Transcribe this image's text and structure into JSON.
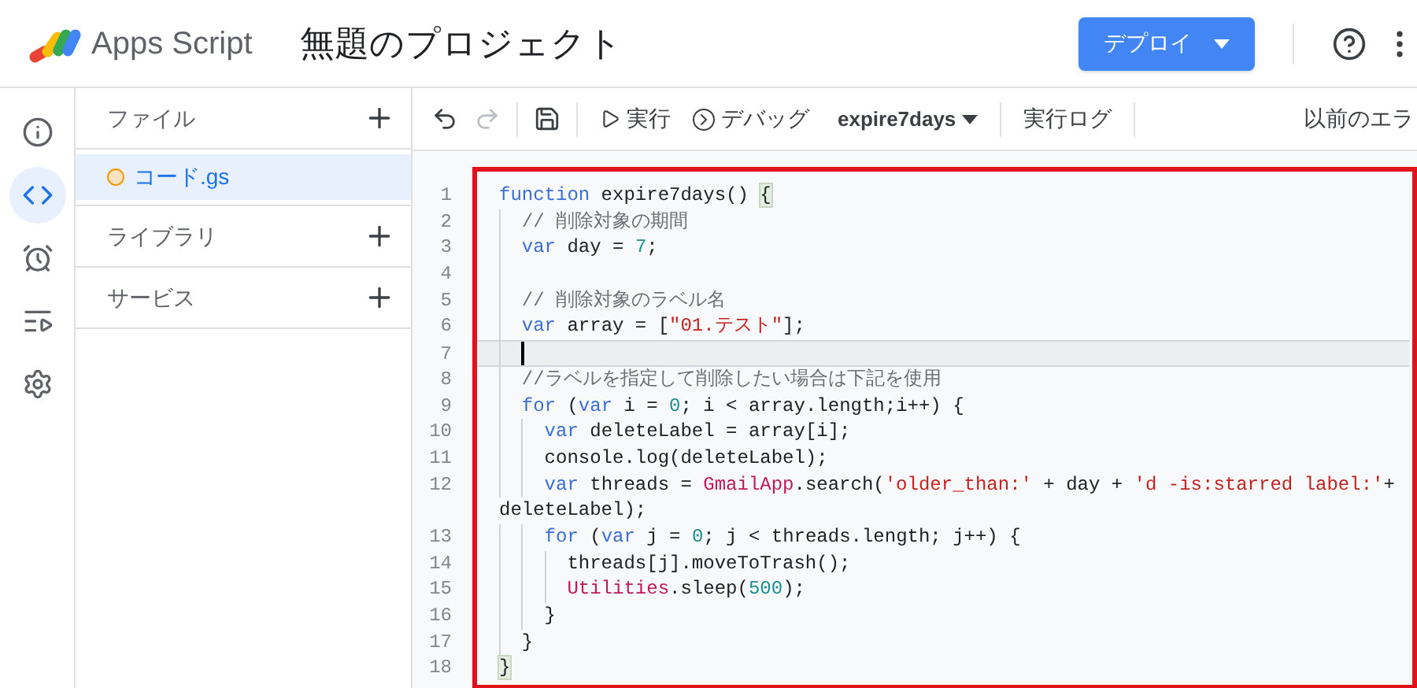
{
  "header": {
    "product": "Apps Script",
    "project_title": "無題のプロジェクト",
    "deploy_button": "デプロイ"
  },
  "rail": [
    {
      "kind": "info",
      "selected": false
    },
    {
      "kind": "editor",
      "selected": true
    },
    {
      "kind": "triggers",
      "selected": false
    },
    {
      "kind": "executions",
      "selected": false
    },
    {
      "kind": "settings",
      "selected": false
    }
  ],
  "files_panel": [
    {
      "title": "ファイル",
      "files": [
        {
          "name": "コード.gs",
          "selected": true
        }
      ]
    },
    {
      "title": "ライブラリ"
    },
    {
      "title": "サービス"
    }
  ],
  "toolbar": {
    "run": "実行",
    "debug": "デバッグ",
    "function_select": "expire7days",
    "log": "実行ログ",
    "previous": "以前のエラ"
  },
  "editor": {
    "lines": [
      {
        "number": "1",
        "current": false,
        "tokens": [
          {
            "kind": "kw",
            "text": "function"
          },
          {
            "kind": "plain",
            "text": " expire7days() "
          },
          {
            "kind": "bracket",
            "text": "{"
          }
        ]
      },
      {
        "number": "2",
        "current": false,
        "tokens": [
          {
            "kind": "comment",
            "text": "  // 削除対象の期間"
          }
        ]
      },
      {
        "number": "3",
        "current": false,
        "tokens": [
          {
            "kind": "kw",
            "text": "  var"
          },
          {
            "kind": "plain",
            "text": " day = "
          },
          {
            "kind": "num",
            "text": "7"
          },
          {
            "kind": "plain",
            "text": ";"
          }
        ]
      },
      {
        "number": "4",
        "current": false
      },
      {
        "number": "5",
        "current": false,
        "tokens": [
          {
            "kind": "comment",
            "text": "  // 削除対象のラベル名"
          }
        ]
      },
      {
        "number": "6",
        "current": false,
        "tokens": [
          {
            "kind": "kw",
            "text": "  var"
          },
          {
            "kind": "plain",
            "text": " array = ["
          },
          {
            "kind": "str",
            "text": "\"01.テスト\""
          },
          {
            "kind": "plain",
            "text": "];"
          }
        ]
      },
      {
        "number": "7",
        "current": true
      },
      {
        "number": "8",
        "current": false,
        "tokens": [
          {
            "kind": "comment",
            "text": "  //ラベルを指定して削除したい場合は下記を使用"
          }
        ]
      },
      {
        "number": "9",
        "current": false,
        "tokens": [
          {
            "kind": "kw",
            "text": "  for"
          },
          {
            "kind": "plain",
            "text": " ("
          },
          {
            "kind": "kw",
            "text": "var"
          },
          {
            "kind": "plain",
            "text": " i = "
          },
          {
            "kind": "num",
            "text": "0"
          },
          {
            "kind": "plain",
            "text": "; i < array.length;i++) {"
          }
        ]
      },
      {
        "number": "10",
        "current": false,
        "tokens": [
          {
            "kind": "kw",
            "text": "    var"
          },
          {
            "kind": "plain",
            "text": " deleteLabel = array[i];"
          }
        ]
      },
      {
        "number": "11",
        "current": false,
        "tokens": [
          {
            "kind": "plain",
            "text": "    console.log(deleteLabel);"
          }
        ]
      },
      {
        "number": "12",
        "current": false,
        "tokens": [
          {
            "kind": "kw",
            "text": "    var"
          },
          {
            "kind": "plain",
            "text": " threads = "
          },
          {
            "kind": "cls",
            "text": "GmailApp"
          },
          {
            "kind": "plain",
            "text": ".search("
          },
          {
            "kind": "str",
            "text": "'older_than:'"
          },
          {
            "kind": "plain",
            "text": " + day + "
          },
          {
            "kind": "str",
            "text": "'d -is:starred label:'"
          },
          {
            "kind": "plain",
            "text": "+"
          }
        ],
        "continuation": "deleteLabel);"
      },
      {
        "number": "13",
        "current": false,
        "tokens": [
          {
            "kind": "kw",
            "text": "    for"
          },
          {
            "kind": "plain",
            "text": " ("
          },
          {
            "kind": "kw",
            "text": "var"
          },
          {
            "kind": "plain",
            "text": " j = "
          },
          {
            "kind": "num",
            "text": "0"
          },
          {
            "kind": "plain",
            "text": "; j < threads.length; j++) {"
          }
        ]
      },
      {
        "number": "14",
        "current": false,
        "tokens": [
          {
            "kind": "plain",
            "text": "      threads[j].moveToTrash();"
          }
        ]
      },
      {
        "number": "15",
        "current": false,
        "tokens": [
          {
            "kind": "cls",
            "text": "      Utilities"
          },
          {
            "kind": "plain",
            "text": ".sleep("
          },
          {
            "kind": "num",
            "text": "500"
          },
          {
            "kind": "plain",
            "text": ");"
          }
        ]
      },
      {
        "number": "16",
        "current": false,
        "tokens": [
          {
            "kind": "plain",
            "text": "    }"
          }
        ]
      },
      {
        "number": "17",
        "current": false,
        "tokens": [
          {
            "kind": "plain",
            "text": "  }"
          }
        ]
      },
      {
        "number": "18",
        "current": false,
        "tokens": [
          {
            "kind": "bracket",
            "text": "}"
          }
        ]
      }
    ]
  }
}
